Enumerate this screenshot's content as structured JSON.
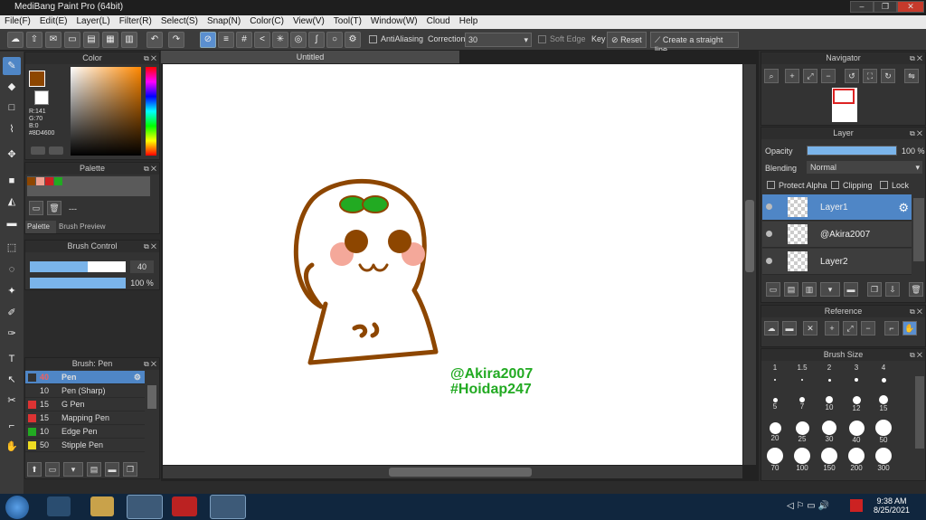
{
  "window": {
    "title": "MediBang Paint Pro (64bit)"
  },
  "menu": [
    "File(F)",
    "Edit(E)",
    "Layer(L)",
    "Filter(R)",
    "Select(S)",
    "Snap(N)",
    "Color(C)",
    "View(V)",
    "Tool(T)",
    "Window(W)",
    "Cloud",
    "Help"
  ],
  "toolbar": {
    "antialiasing": "AntiAliasing",
    "correction_label": "Correction",
    "correction_value": "30",
    "soft_edge": "Soft Edge",
    "key": "Key",
    "reset": "Reset",
    "straight_line": "Create a straight line"
  },
  "canvas": {
    "tab": "Untitled",
    "watermark1": "@Akira2007",
    "watermark2": "#Hoidap247"
  },
  "color_panel": {
    "title": "Color",
    "r": "R:141",
    "g": "G:70",
    "b": "B:0",
    "hex": "#8D4600",
    "accent": "#8D4600"
  },
  "palette_panel": {
    "title": "Palette",
    "value": "---",
    "tab1": "Palette",
    "tab2": "Brush Preview",
    "colors": [
      "#8D4600",
      "#f0a090",
      "#cc2222",
      "#22aa22"
    ]
  },
  "brush_control": {
    "title": "Brush Control",
    "size": "40",
    "opacity": "100 %",
    "size_fraction": 0.6,
    "opacity_fraction": 1.0
  },
  "brush_list": {
    "title": "Brush: Pen",
    "items": [
      {
        "size": "40",
        "name": "Pen",
        "color": "#333333"
      },
      {
        "size": "10",
        "name": "Pen (Sharp)",
        "color": "#333333"
      },
      {
        "size": "15",
        "name": "G Pen",
        "color": "#dd3333"
      },
      {
        "size": "15",
        "name": "Mapping Pen",
        "color": "#dd3333"
      },
      {
        "size": "10",
        "name": "Edge Pen",
        "color": "#22aa22"
      },
      {
        "size": "50",
        "name": "Stipple Pen",
        "color": "#eedd22"
      }
    ]
  },
  "navigator": {
    "title": "Navigator"
  },
  "layer_panel": {
    "title": "Layer",
    "opacity_label": "Opacity",
    "opacity_value": "100 %",
    "blending_label": "Blending",
    "blending_value": "Normal",
    "protect_alpha": "Protect Alpha",
    "clipping": "Clipping",
    "lock": "Lock",
    "layers": [
      {
        "name": "Layer1",
        "selected": true
      },
      {
        "name": "@Akira2007",
        "selected": false
      },
      {
        "name": "Layer2",
        "selected": false
      }
    ]
  },
  "reference": {
    "title": "Reference"
  },
  "brush_size": {
    "title": "Brush Size",
    "sizes": [
      "1",
      "1.5",
      "2",
      "3",
      "4",
      "5",
      "7",
      "10",
      "12",
      "15",
      "20",
      "25",
      "30",
      "40",
      "50",
      "70",
      "100",
      "150",
      "200",
      "300"
    ]
  },
  "taskbar": {
    "time": "9:38 AM",
    "date": "8/25/2021"
  }
}
